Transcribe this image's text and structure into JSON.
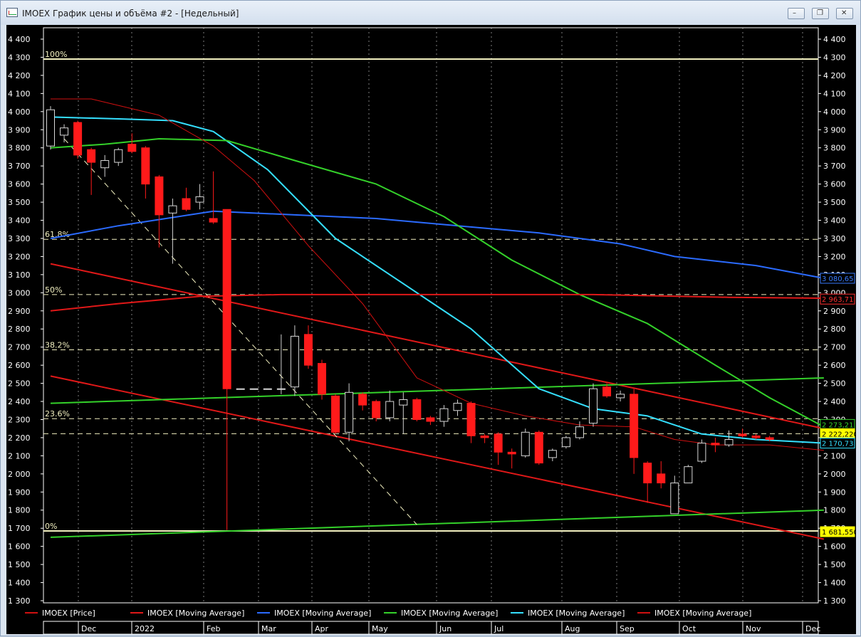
{
  "window": {
    "title": "IMOEX График цены и объёма #2 - [Недельный]",
    "minimize_label": "–",
    "restore_label": "❐",
    "close_label": "✕"
  },
  "colors": {
    "background": "#000000",
    "bull": "#000000",
    "bear": "#ff1a1a",
    "ma_thin_red": "#d01010",
    "ma_red": "#e01818",
    "ma_blue": "#2b6bff",
    "ma_green": "#34d12a",
    "ma_cyan": "#35e0ff",
    "fib": "#f2f0c0",
    "grid": "#ffffff"
  },
  "chart_data": {
    "type": "candlestick",
    "ylim": [
      1300,
      4400
    ],
    "y_ticks": [
      "4 400",
      "4 300",
      "4 200",
      "4 100",
      "4 000",
      "3 900",
      "3 800",
      "3 700",
      "3 600",
      "3 500",
      "3 400",
      "3 300",
      "3 200",
      "3 100",
      "3 000",
      "2 900",
      "2 800",
      "2 700",
      "2 600",
      "2 500",
      "2 400",
      "2 300",
      "2 200",
      "2 100",
      "2 000",
      "1 900",
      "1 800",
      "1 700",
      "1 600",
      "1 500",
      "1 400",
      "1 300"
    ],
    "x_labels": [
      "Dec",
      "2022",
      "Feb",
      "Mar",
      "Apr",
      "May",
      "Jun",
      "Jul",
      "Aug",
      "Sep",
      "Oct",
      "Nov",
      "Dec"
    ],
    "n_slots": 58,
    "candles": [
      {
        "i": 0,
        "o": 3810,
        "h": 4030,
        "l": 3790,
        "c": 4010
      },
      {
        "i": 1,
        "o": 3870,
        "h": 3930,
        "l": 3830,
        "c": 3910
      },
      {
        "i": 2,
        "o": 3940,
        "h": 3950,
        "l": 3740,
        "c": 3760
      },
      {
        "i": 3,
        "o": 3790,
        "h": 3800,
        "l": 3540,
        "c": 3720
      },
      {
        "i": 4,
        "o": 3690,
        "h": 3760,
        "l": 3640,
        "c": 3730
      },
      {
        "i": 5,
        "o": 3720,
        "h": 3800,
        "l": 3700,
        "c": 3790
      },
      {
        "i": 6,
        "o": 3820,
        "h": 3880,
        "l": 3770,
        "c": 3780
      },
      {
        "i": 7,
        "o": 3800,
        "h": 3810,
        "l": 3520,
        "c": 3600
      },
      {
        "i": 8,
        "o": 3640,
        "h": 3650,
        "l": 3250,
        "c": 3430
      },
      {
        "i": 9,
        "o": 3440,
        "h": 3520,
        "l": 3160,
        "c": 3480
      },
      {
        "i": 10,
        "o": 3520,
        "h": 3580,
        "l": 3450,
        "c": 3460
      },
      {
        "i": 11,
        "o": 3500,
        "h": 3600,
        "l": 3460,
        "c": 3530
      },
      {
        "i": 12,
        "o": 3410,
        "h": 3670,
        "l": 3380,
        "c": 3390
      },
      {
        "i": 13,
        "o": 3460,
        "h": 3460,
        "l": 1690,
        "c": 2470
      },
      {
        "i": 14,
        "o": 2470,
        "h": 2470,
        "l": 2470,
        "c": 2470
      },
      {
        "i": 15,
        "o": 2470,
        "h": 2470,
        "l": 2470,
        "c": 2470
      },
      {
        "i": 16,
        "o": 2470,
        "h": 2470,
        "l": 2470,
        "c": 2470
      },
      {
        "i": 17,
        "o": 2470,
        "h": 2770,
        "l": 2440,
        "c": 2470
      },
      {
        "i": 18,
        "o": 2480,
        "h": 2820,
        "l": 2430,
        "c": 2760
      },
      {
        "i": 19,
        "o": 2770,
        "h": 2820,
        "l": 2580,
        "c": 2600
      },
      {
        "i": 20,
        "o": 2610,
        "h": 2630,
        "l": 2410,
        "c": 2440
      },
      {
        "i": 21,
        "o": 2430,
        "h": 2440,
        "l": 2220,
        "c": 2230
      },
      {
        "i": 22,
        "o": 2230,
        "h": 2500,
        "l": 2180,
        "c": 2450
      },
      {
        "i": 23,
        "o": 2440,
        "h": 2450,
        "l": 2350,
        "c": 2380
      },
      {
        "i": 24,
        "o": 2400,
        "h": 2410,
        "l": 2290,
        "c": 2310
      },
      {
        "i": 25,
        "o": 2310,
        "h": 2460,
        "l": 2290,
        "c": 2400
      },
      {
        "i": 26,
        "o": 2380,
        "h": 2450,
        "l": 2220,
        "c": 2410
      },
      {
        "i": 27,
        "o": 2410,
        "h": 2420,
        "l": 2290,
        "c": 2300
      },
      {
        "i": 28,
        "o": 2310,
        "h": 2320,
        "l": 2270,
        "c": 2290
      },
      {
        "i": 29,
        "o": 2290,
        "h": 2380,
        "l": 2260,
        "c": 2360
      },
      {
        "i": 30,
        "o": 2350,
        "h": 2410,
        "l": 2320,
        "c": 2390
      },
      {
        "i": 31,
        "o": 2390,
        "h": 2400,
        "l": 2170,
        "c": 2210
      },
      {
        "i": 32,
        "o": 2210,
        "h": 2220,
        "l": 2170,
        "c": 2200
      },
      {
        "i": 33,
        "o": 2220,
        "h": 2230,
        "l": 2050,
        "c": 2120
      },
      {
        "i": 34,
        "o": 2120,
        "h": 2140,
        "l": 2030,
        "c": 2110
      },
      {
        "i": 35,
        "o": 2100,
        "h": 2250,
        "l": 2090,
        "c": 2230
      },
      {
        "i": 36,
        "o": 2230,
        "h": 2240,
        "l": 2050,
        "c": 2060
      },
      {
        "i": 37,
        "o": 2090,
        "h": 2140,
        "l": 2070,
        "c": 2130
      },
      {
        "i": 38,
        "o": 2150,
        "h": 2210,
        "l": 2140,
        "c": 2200
      },
      {
        "i": 39,
        "o": 2200,
        "h": 2290,
        "l": 2190,
        "c": 2260
      },
      {
        "i": 40,
        "o": 2280,
        "h": 2500,
        "l": 2260,
        "c": 2470
      },
      {
        "i": 41,
        "o": 2480,
        "h": 2500,
        "l": 2420,
        "c": 2430
      },
      {
        "i": 42,
        "o": 2420,
        "h": 2460,
        "l": 2400,
        "c": 2440
      },
      {
        "i": 43,
        "o": 2440,
        "h": 2470,
        "l": 2000,
        "c": 2090
      },
      {
        "i": 44,
        "o": 2060,
        "h": 2070,
        "l": 1840,
        "c": 1950
      },
      {
        "i": 45,
        "o": 2000,
        "h": 2070,
        "l": 1920,
        "c": 1950
      },
      {
        "i": 46,
        "o": 1780,
        "h": 1990,
        "l": 1780,
        "c": 1950
      },
      {
        "i": 47,
        "o": 1950,
        "h": 2050,
        "l": 1950,
        "c": 2040
      },
      {
        "i": 48,
        "o": 2070,
        "h": 2190,
        "l": 2060,
        "c": 2170
      },
      {
        "i": 49,
        "o": 2170,
        "h": 2200,
        "l": 2120,
        "c": 2160
      },
      {
        "i": 50,
        "o": 2160,
        "h": 2240,
        "l": 2150,
        "c": 2190
      },
      {
        "i": 51,
        "o": 2220,
        "h": 2250,
        "l": 2200,
        "c": 2210
      },
      {
        "i": 52,
        "o": 2210,
        "h": 2220,
        "l": 2190,
        "c": 2200
      },
      {
        "i": 53,
        "o": 2200,
        "h": 2210,
        "l": 2180,
        "c": 2190
      }
    ],
    "moving_averages": [
      {
        "color_key": "ma_blue",
        "width": 2,
        "points": [
          [
            0,
            3300
          ],
          [
            5,
            3370
          ],
          [
            12,
            3450
          ],
          [
            18,
            3430
          ],
          [
            24,
            3410
          ],
          [
            30,
            3370
          ],
          [
            36,
            3330
          ],
          [
            42,
            3270
          ],
          [
            46,
            3200
          ],
          [
            52,
            3150
          ],
          [
            57,
            3080
          ]
        ]
      },
      {
        "color_key": "ma_cyan",
        "width": 2,
        "points": [
          [
            0,
            3970
          ],
          [
            5,
            3960
          ],
          [
            9,
            3950
          ],
          [
            12,
            3890
          ],
          [
            16,
            3680
          ],
          [
            21,
            3300
          ],
          [
            26,
            3050
          ],
          [
            31,
            2800
          ],
          [
            36,
            2470
          ],
          [
            40,
            2360
          ],
          [
            44,
            2320
          ],
          [
            48,
            2220
          ],
          [
            52,
            2190
          ],
          [
            57,
            2170
          ]
        ]
      },
      {
        "color_key": "ma_green",
        "width": 2,
        "points": [
          [
            0,
            3800
          ],
          [
            4,
            3820
          ],
          [
            8,
            3850
          ],
          [
            13,
            3840
          ],
          [
            18,
            3730
          ],
          [
            24,
            3600
          ],
          [
            29,
            3420
          ],
          [
            34,
            3180
          ],
          [
            39,
            2990
          ],
          [
            44,
            2830
          ],
          [
            49,
            2600
          ],
          [
            53,
            2420
          ],
          [
            57,
            2260
          ]
        ]
      },
      {
        "color_key": "ma_thin_red",
        "width": 1,
        "points": [
          [
            0,
            4070
          ],
          [
            3,
            4070
          ],
          [
            8,
            3980
          ],
          [
            12,
            3810
          ],
          [
            15,
            3620
          ],
          [
            19,
            3260
          ],
          [
            23,
            2940
          ],
          [
            27,
            2530
          ],
          [
            31,
            2390
          ],
          [
            35,
            2320
          ],
          [
            39,
            2270
          ],
          [
            43,
            2260
          ],
          [
            46,
            2190
          ],
          [
            49,
            2160
          ],
          [
            53,
            2160
          ],
          [
            57,
            2130
          ]
        ]
      },
      {
        "color_key": "ma_red",
        "width": 2,
        "points": [
          [
            0,
            2900
          ],
          [
            5,
            2940
          ],
          [
            11,
            2980
          ],
          [
            17,
            2990
          ],
          [
            23,
            2990
          ],
          [
            31,
            2990
          ],
          [
            40,
            2990
          ],
          [
            50,
            2975
          ],
          [
            57,
            2970
          ]
        ]
      }
    ],
    "trend_lines": [
      {
        "color_key": "ma_red",
        "width": 2,
        "from": [
          0,
          3160
        ],
        "to": [
          57,
          2250
        ]
      },
      {
        "color_key": "ma_red",
        "width": 2,
        "from": [
          0,
          2540
        ],
        "to": [
          57,
          1640
        ]
      },
      {
        "color_key": "ma_green",
        "width": 2,
        "from": [
          0,
          2390
        ],
        "to": [
          57,
          2530
        ]
      },
      {
        "color_key": "ma_green",
        "width": 2,
        "from": [
          0,
          1650
        ],
        "to": [
          57,
          1800
        ]
      },
      {
        "color_key": "fib",
        "width": 1,
        "dash": true,
        "from": [
          1,
          3850
        ],
        "to": [
          27,
          1720
        ]
      }
    ],
    "fib_levels": [
      {
        "label": "100%",
        "value": 4290,
        "solid": true
      },
      {
        "label": "61.8%",
        "value": 3295,
        "solid": false
      },
      {
        "label": "50%",
        "value": 2990,
        "solid": false
      },
      {
        "label": "38.2%",
        "value": 2685,
        "solid": false
      },
      {
        "label": "23.6%",
        "value": 2305,
        "solid": false
      },
      {
        "label": "",
        "value": 2222,
        "solid": false
      },
      {
        "label": "0%",
        "value": 1685,
        "solid": true
      }
    ],
    "right_badges": [
      {
        "text": "3 080,65",
        "value": 3080,
        "bg": "#000000",
        "fg": "#3a7cff",
        "border": "#3a7cff"
      },
      {
        "text": "2 963,71",
        "value": 2965,
        "bg": "#000000",
        "fg": "#ff3030",
        "border": "#ff3030"
      },
      {
        "text": "2 273,21",
        "value": 2273,
        "bg": "#000000",
        "fg": "#34d12a",
        "border": "#34d12a"
      },
      {
        "text": "2 222,220",
        "value": 2222,
        "bg": "#ffff00",
        "fg": "#000000",
        "border": "#ffff00"
      },
      {
        "text": "2 170,73",
        "value": 2170,
        "bg": "#000000",
        "fg": "#35e0ff",
        "border": "#35e0ff"
      },
      {
        "text": "1 681,550",
        "value": 1681,
        "bg": "#ffff00",
        "fg": "#000000",
        "border": "#ffff00"
      }
    ],
    "legend": [
      {
        "label": "IMOEX [Price]",
        "color_key": "ma_thin_red"
      },
      {
        "label": "IMOEX [Moving Average]",
        "color_key": "ma_red"
      },
      {
        "label": "IMOEX [Moving Average]",
        "color_key": "ma_blue"
      },
      {
        "label": "IMOEX [Moving Average]",
        "color_key": "ma_green"
      },
      {
        "label": "IMOEX [Moving Average]",
        "color_key": "ma_cyan"
      },
      {
        "label": "IMOEX [Moving Average]",
        "color_key": "ma_thin_red"
      }
    ]
  }
}
